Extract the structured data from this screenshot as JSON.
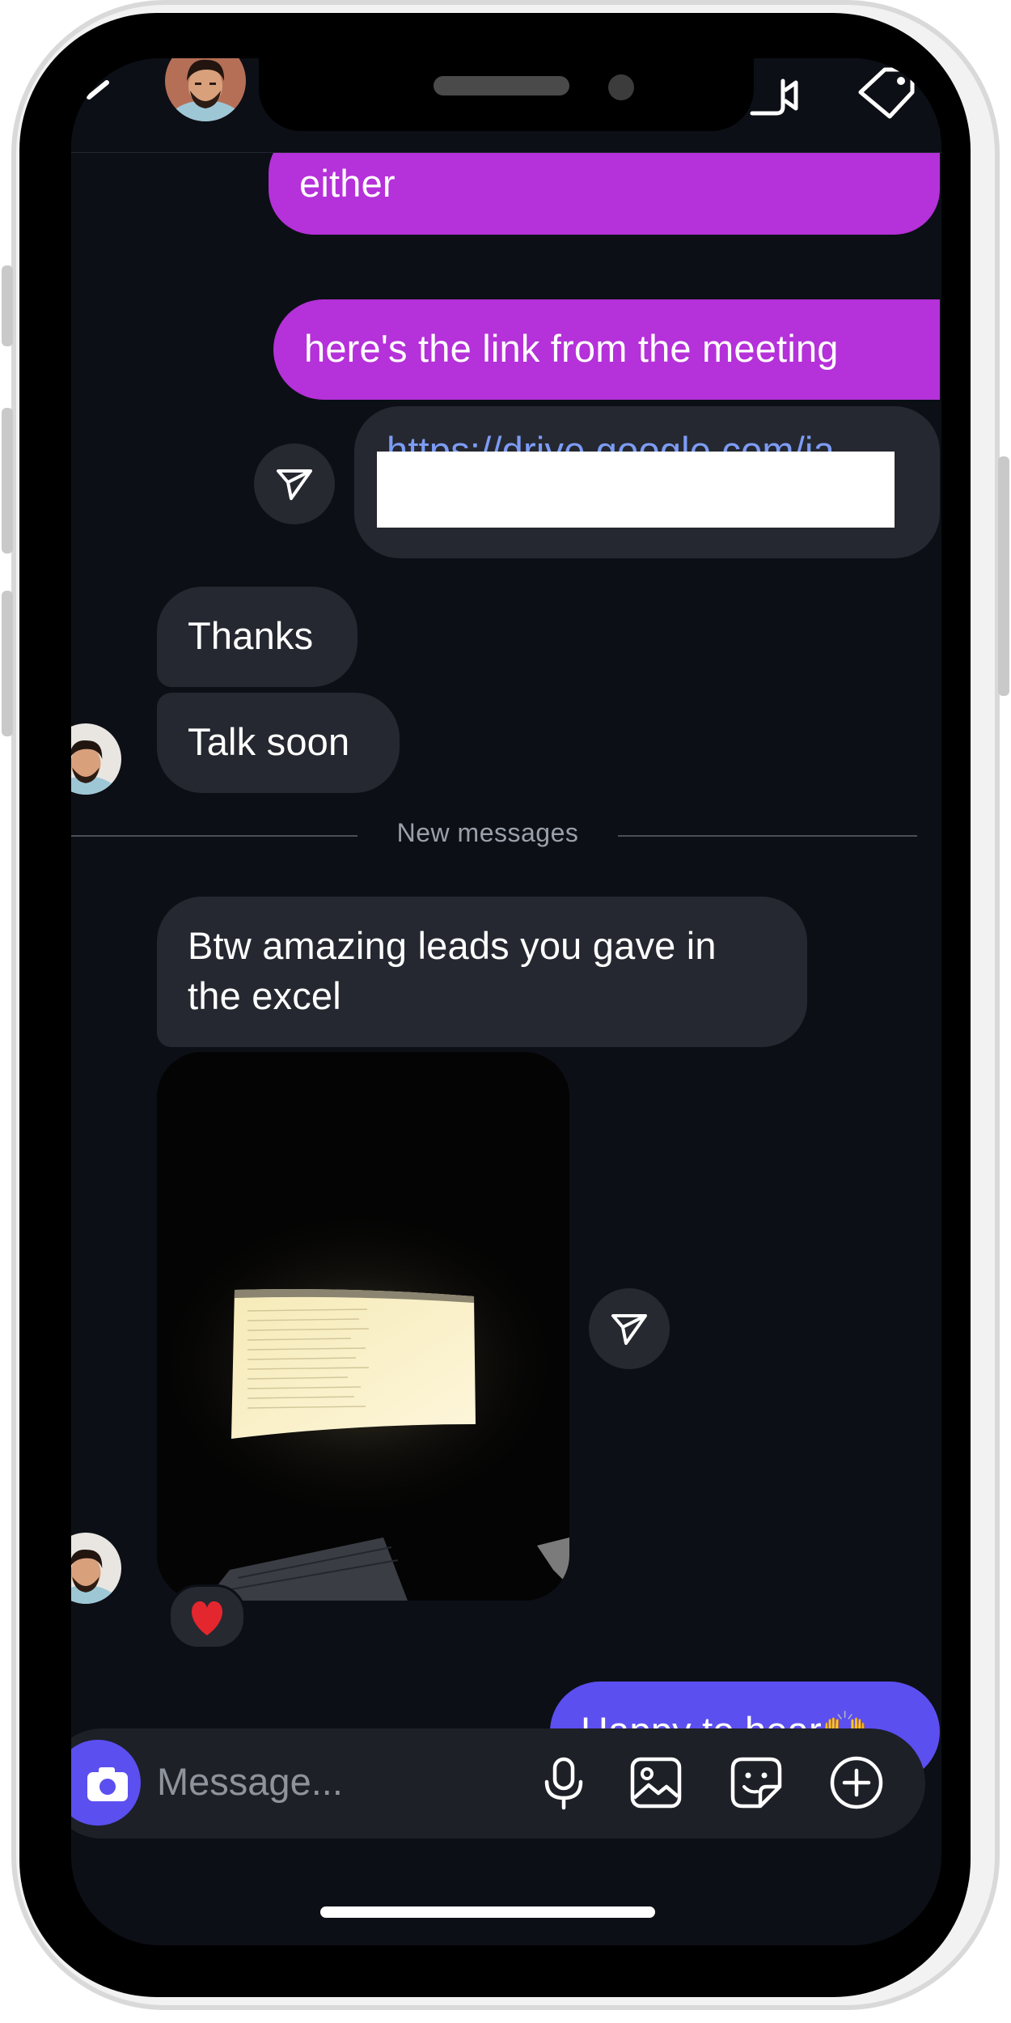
{
  "header": {
    "back_icon": "chevron-left-icon",
    "avatar_icon": "contact-avatar",
    "video_icon": "video-camera-icon",
    "tag_icon": "tag-icon"
  },
  "messages": {
    "out_either": "either",
    "out_link_label": "here's the link from the meeting",
    "out_link_url": "https://drive.google.com/ja",
    "in_thanks": "Thanks",
    "in_talk_soon": "Talk soon",
    "divider": "New messages",
    "in_leads_line1": "Btw amazing leads you gave in",
    "in_leads_line2": "the excel",
    "reaction": "❤️",
    "out_happy": "Happy to hear",
    "out_happy_emoji": "🙌"
  },
  "composer": {
    "placeholder": "Message...",
    "camera_icon": "camera-icon",
    "mic_icon": "microphone-icon",
    "gallery_icon": "image-icon",
    "sticker_icon": "sticker-icon",
    "add_icon": "plus-circle-icon"
  },
  "colors": {
    "background": "#0c0f16",
    "outgoing_purple": "#b531d9",
    "outgoing_blue": "#5b4ff0",
    "incoming_bubble": "#252830",
    "link": "#7d9cf5"
  }
}
